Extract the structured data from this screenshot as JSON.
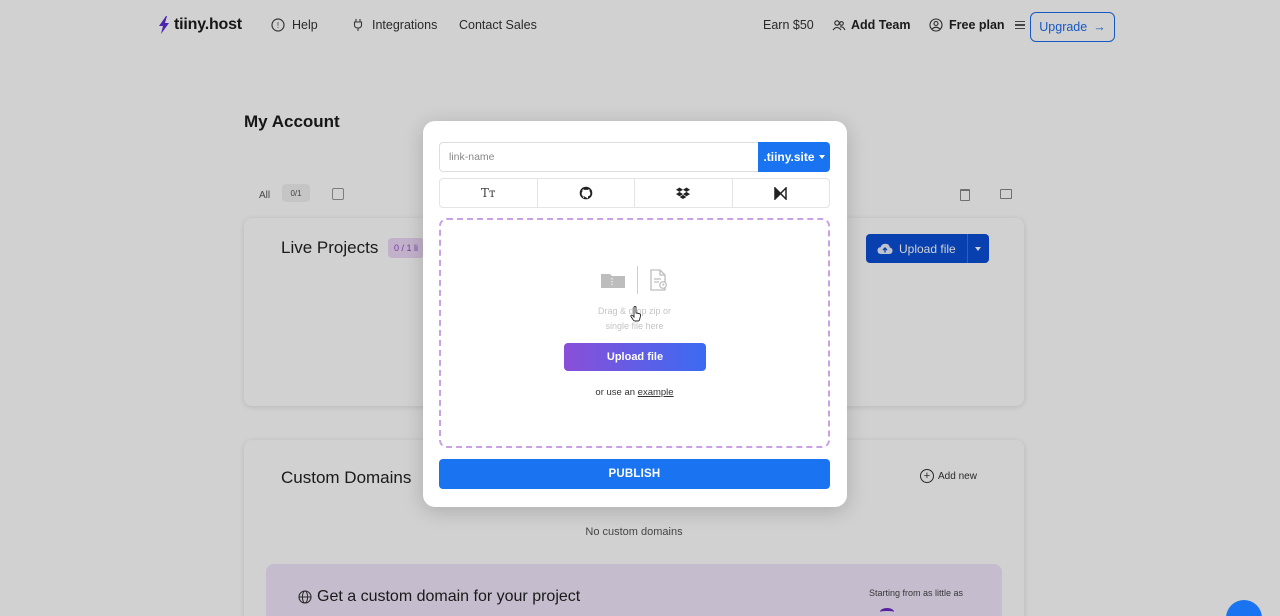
{
  "nav": {
    "logo": "tiiny.host",
    "help": "Help",
    "integrations": "Integrations",
    "contact_sales": "Contact Sales",
    "earn": "Earn $50",
    "add_team": "Add Team",
    "free_plan": "Free plan",
    "upgrade": "Upgrade",
    "upgrade_arrow": "→"
  },
  "page": {
    "title": "My Account",
    "filter_all": "All",
    "filter_count": "0/1"
  },
  "live_projects": {
    "title": "Live Projects",
    "badge": "0 / 1 li",
    "upload_label": "Upload file"
  },
  "domains": {
    "title": "Custom Domains",
    "add_new": "Add new",
    "empty": "No custom domains",
    "promo_title": "Get a custom domain for your project",
    "promo_price": "Starting from as little as"
  },
  "modal": {
    "link_placeholder": "link-name",
    "suffix": ".tiiny.site",
    "tabs": [
      {
        "icon": "text-icon",
        "glyph": "Tт"
      },
      {
        "icon": "github-icon"
      },
      {
        "icon": "dropbox-icon"
      },
      {
        "icon": "ai-builder-icon"
      }
    ],
    "drop_hint_line1": "Drag & drop zip or",
    "drop_hint_line2": "single file here",
    "upload_button": "Upload file",
    "example_prefix": "or use an",
    "example_link": "example",
    "publish": "PUBLISH"
  },
  "colors": {
    "primary": "#1a73f0",
    "dark_primary": "#0a4fd6",
    "purple": "#8a4fd8",
    "dashed_border": "#c9a2e6",
    "promo_bg": "#f1e6fa"
  }
}
